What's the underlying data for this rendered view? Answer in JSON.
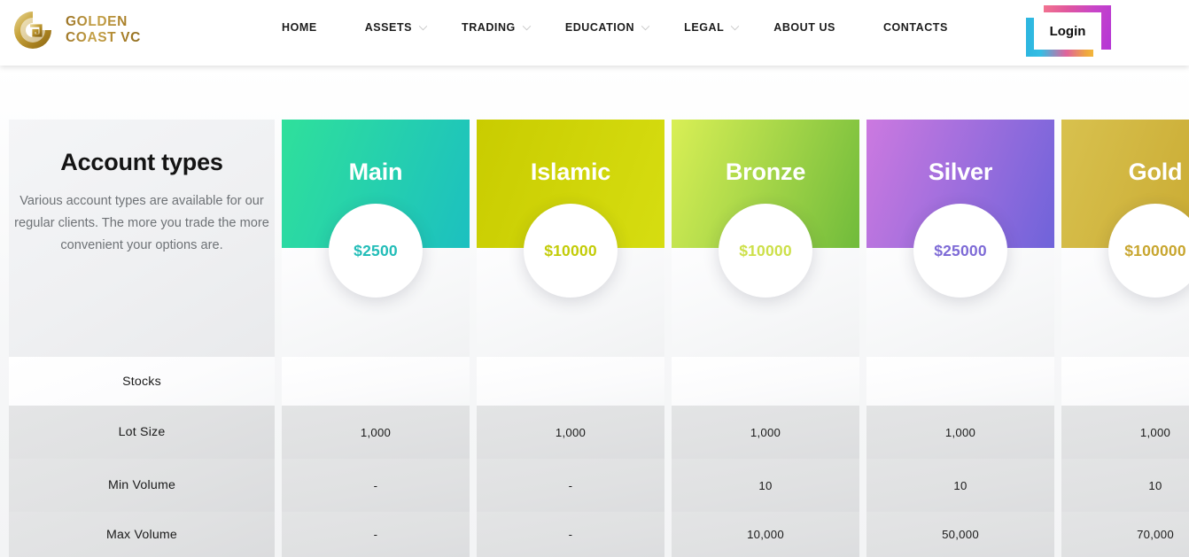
{
  "brand": {
    "name_line1": "GOLDEN",
    "name_line2": "COAST VC",
    "logo_icon": "golden-coast-vc-logo-icon",
    "gold_accent": "#b08a33"
  },
  "nav": {
    "items": [
      {
        "label": "HOME",
        "has_dropdown": false
      },
      {
        "label": "ASSETS",
        "has_dropdown": true
      },
      {
        "label": "TRADING",
        "has_dropdown": true
      },
      {
        "label": "EDUCATION",
        "has_dropdown": true
      },
      {
        "label": "LEGAL",
        "has_dropdown": true
      },
      {
        "label": "ABOUT US",
        "has_dropdown": false
      },
      {
        "label": "CONTACTS",
        "has_dropdown": false
      }
    ],
    "chevron_icon": "chevron-down-icon"
  },
  "login": {
    "label": "Login",
    "frame_top_start": "#f2748f",
    "frame_top_end": "#b436d6",
    "frame_bottom_start": "#2cb6e0",
    "frame_bottom_end": "#f2b63a"
  },
  "info": {
    "title": "Account types",
    "description": "Various account types are available for our regular clients. The more you trade the more convenient your options are."
  },
  "table": {
    "row_labels": [
      "Stocks",
      "Lot Size",
      "Min Volume",
      "Max Volume"
    ],
    "columns": [
      {
        "name": "Main",
        "price": "$2500",
        "price_color": "#23bdb8",
        "grad_start": "#2fe09b",
        "grad_end": "#1cc0c0",
        "values": [
          "",
          "1,000",
          "-",
          "-"
        ]
      },
      {
        "name": "Islamic",
        "price": "$10000",
        "price_color": "#c3cc08",
        "grad_start": "#c9cc00",
        "grad_end": "#d6dd11",
        "values": [
          "",
          "1,000",
          "-",
          "-"
        ]
      },
      {
        "name": "Bronze",
        "price": "$10000",
        "price_color": "#cde04a",
        "grad_start": "#d9ef55",
        "grad_end": "#70bb3b",
        "values": [
          "",
          "1,000",
          "10",
          "10,000"
        ]
      },
      {
        "name": "Silver",
        "price": "$25000",
        "price_color": "#7e6bd6",
        "grad_start": "#cc79e0",
        "grad_end": "#6f63da",
        "values": [
          "",
          "1,000",
          "10",
          "50,000"
        ]
      },
      {
        "name": "Gold",
        "price": "$100000",
        "price_color": "#c8a62f",
        "grad_start": "#d8c14e",
        "grad_end": "#c6a52c",
        "values": [
          "",
          "1,000",
          "10",
          "70,000"
        ]
      }
    ]
  }
}
